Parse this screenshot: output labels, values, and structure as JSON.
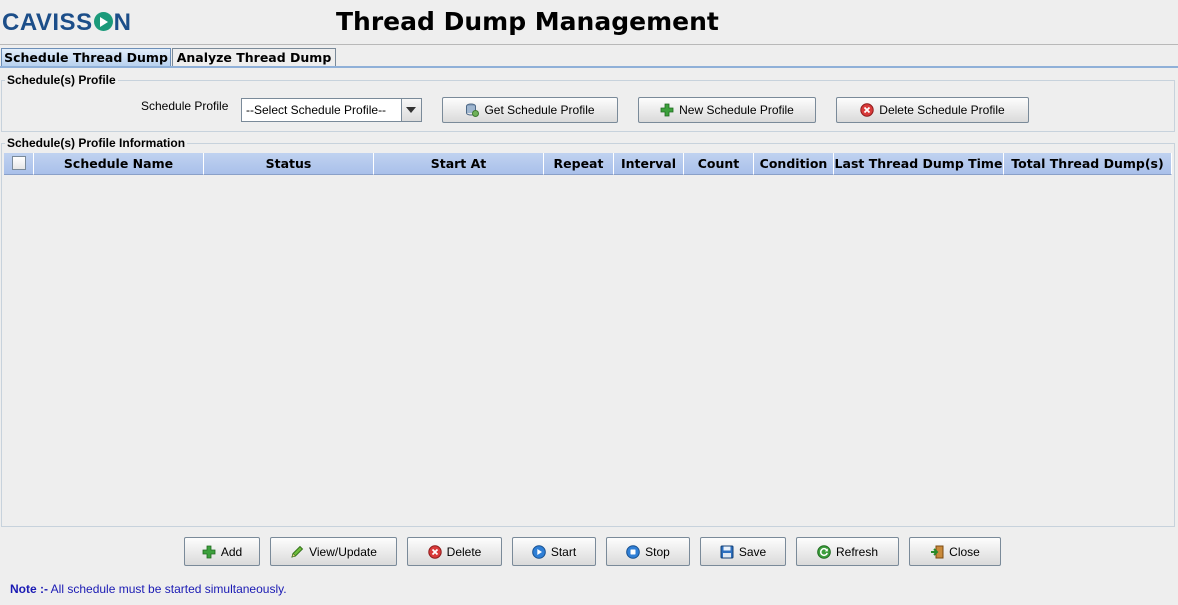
{
  "header": {
    "logo_text_left": "CAVISS",
    "logo_text_right": "N",
    "title": "Thread Dump Management"
  },
  "tabs": [
    {
      "label": "Schedule Thread Dump",
      "selected": true
    },
    {
      "label": "Analyze Thread Dump",
      "selected": false
    }
  ],
  "profile_section": {
    "legend": "Schedule(s) Profile",
    "label": "Schedule Profile",
    "select_value": "--Select Schedule Profile--",
    "get_button": "Get Schedule Profile",
    "new_button": "New Schedule Profile",
    "delete_button": "Delete Schedule Profile"
  },
  "info_section": {
    "legend": "Schedule(s) Profile Information",
    "columns": [
      "Schedule Name",
      "Status",
      "Start At",
      "Repeat",
      "Interval",
      "Count",
      "Condition",
      "Last Thread Dump Time",
      "Total Thread Dump(s)"
    ],
    "rows": []
  },
  "actions": {
    "add": "Add",
    "view_update": "View/Update",
    "delete": "Delete",
    "start": "Start",
    "stop": "Stop",
    "save": "Save",
    "refresh": "Refresh",
    "close": "Close"
  },
  "note": {
    "prefix": "Note :-",
    "text": " All schedule must be started simultaneously."
  },
  "colors": {
    "brand": "#1c4e89",
    "table_header": "#b4c8ee",
    "note": "#1a1ab4"
  }
}
